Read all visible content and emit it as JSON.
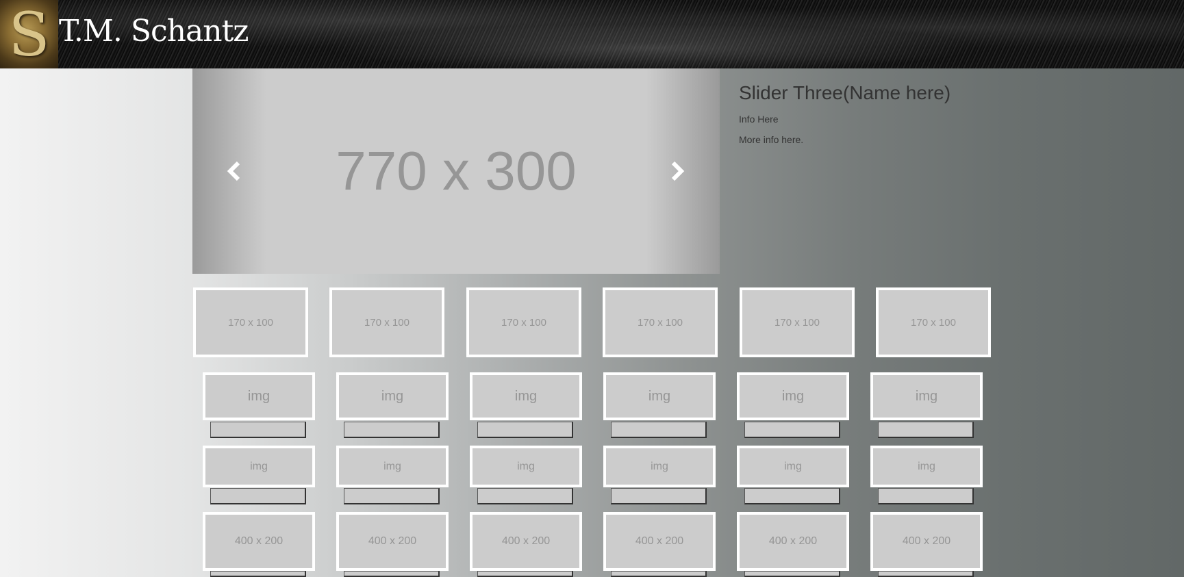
{
  "header": {
    "site_title": "T.M. Schantz",
    "logo_letter": "S"
  },
  "slider": {
    "placeholder": "770 x 300",
    "prev_icon": "chevron-left-icon",
    "next_icon": "chevron-right-icon",
    "title": "Slider Three(Name here)",
    "info": "Info Here",
    "more_info": "More info here."
  },
  "thumbnails": [
    "170 x 100",
    "170 x 100",
    "170 x 100",
    "170 x 100",
    "170 x 100",
    "170 x 100"
  ],
  "grid": {
    "row1": [
      "img",
      "img",
      "img",
      "img",
      "img",
      "img"
    ],
    "row2": [
      "img",
      "img",
      "img",
      "img",
      "img",
      "img"
    ],
    "row3": [
      "400 x 200",
      "400 x 200",
      "400 x 200",
      "400 x 200",
      "400 x 200",
      "400 x 200"
    ]
  },
  "colors": {
    "placeholder_bg": "#cccccc",
    "placeholder_text": "#969696",
    "border": "#ffffff"
  }
}
